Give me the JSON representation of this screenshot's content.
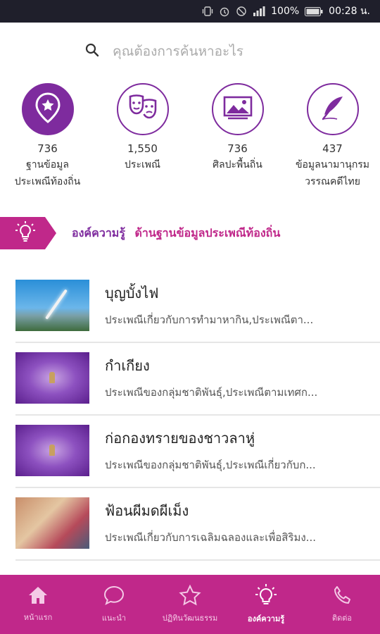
{
  "status_bar": {
    "battery": "100%",
    "time": "00:28 น."
  },
  "search": {
    "placeholder": "คุณต้องการค้นหาอะไร"
  },
  "categories": [
    {
      "icon": "location-star-icon",
      "count": "736",
      "label_line1": "ฐานข้อมูล",
      "label_line2": "ประเพณีท้องถิ่น"
    },
    {
      "icon": "theater-masks-icon",
      "count": "1,550",
      "label_line1": "ประเพณี",
      "label_line2": ""
    },
    {
      "icon": "landscape-picture-icon",
      "count": "736",
      "label_line1": "ศิลปะพื้นถิ่น",
      "label_line2": ""
    },
    {
      "icon": "feather-quill-icon",
      "count": "437",
      "label_line1": "ข้อมูลนามานุกรม",
      "label_line2": "วรรณคดีไทย"
    }
  ],
  "banner": {
    "label_a": "องค์ความรู้",
    "label_b": "ด้านฐานข้อมูลประเพณีท้องถิ่น"
  },
  "items": [
    {
      "title": "บุญบั้งไฟ",
      "desc": "ประเพณีเกี่ยวกับการทำมาหากิน,ประเพณีตา..."
    },
    {
      "title": "กำเกียง",
      "desc": "ประเพณีของกลุ่มชาติพันธุ์,ประเพณีตามเทศก..."
    },
    {
      "title": "ก่อกองทรายของชาวลาหู่",
      "desc": "ประเพณีของกลุ่มชาติพันธุ์,ประเพณีเกี่ยวกับก..."
    },
    {
      "title": "ฟ้อนผีมดผีเม็ง",
      "desc": "ประเพณีเกี่ยวกับการเฉลิมฉลองและเพื่อสิริมง..."
    }
  ],
  "nav": [
    {
      "icon": "home-icon",
      "label": "หน้าแรก"
    },
    {
      "icon": "chat-bubble-icon",
      "label": "แนะนำ"
    },
    {
      "icon": "star-icon",
      "label": "ปฏิทินวัฒนธรรม"
    },
    {
      "icon": "lightbulb-icon",
      "label": "องค์ความรู้"
    },
    {
      "icon": "phone-icon",
      "label": "ติดต่อ"
    }
  ],
  "colors": {
    "primary_purple": "#7e2b9e",
    "accent_magenta": "#c0288a",
    "status_bar": "#1f1f2b"
  }
}
